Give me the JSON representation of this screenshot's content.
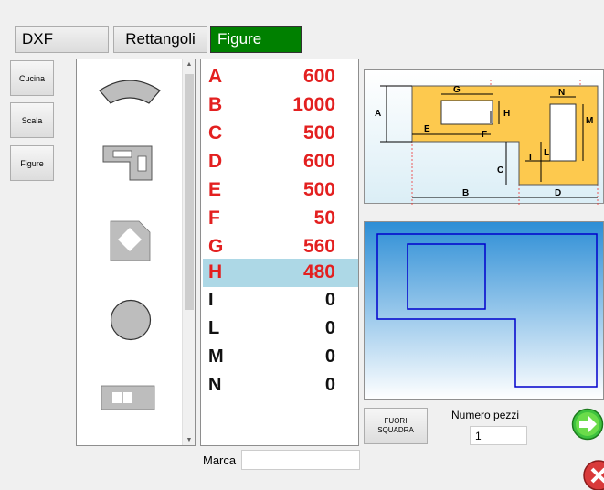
{
  "top_tabs": {
    "dxf": "DXF",
    "rettangoli": "Rettangoli",
    "figure": "Figure"
  },
  "side_buttons": {
    "cucina": "Cucina",
    "scala": "Scala",
    "figure": "Figure"
  },
  "shapes_list": {
    "icons": [
      "arc-shape-icon",
      "notched-rectangle-shape-icon",
      "diamond-cutout-shape-icon",
      "circle-shape-icon",
      "two-holes-shape-icon"
    ]
  },
  "params": [
    {
      "key": "A",
      "value": "600"
    },
    {
      "key": "B",
      "value": "1000"
    },
    {
      "key": "C",
      "value": "500"
    },
    {
      "key": "D",
      "value": "600"
    },
    {
      "key": "E",
      "value": "500"
    },
    {
      "key": "F",
      "value": "50"
    },
    {
      "key": "G",
      "value": "560"
    },
    {
      "key": "H",
      "value": "480",
      "selected": true
    },
    {
      "key": "I",
      "value": "0"
    },
    {
      "key": "L",
      "value": "0"
    },
    {
      "key": "M",
      "value": "0"
    },
    {
      "key": "N",
      "value": "0"
    }
  ],
  "marca": {
    "label": "Marca",
    "value": ""
  },
  "diagram_labels": {
    "a": "A",
    "b": "B",
    "c": "C",
    "d": "D",
    "e": "E",
    "f": "F",
    "g": "G",
    "h": "H",
    "i": "I",
    "l": "L",
    "m": "M",
    "n": "N"
  },
  "fuori_squadra": {
    "line1": "FUORI",
    "line2": "SQUADRA"
  },
  "numero_pezzi": {
    "label": "Numero pezzi",
    "value": "1"
  },
  "colors": {
    "active_tab": "#008000",
    "param_red": "#e32020",
    "selected_row": "#add8e6",
    "shape_fill": "#fdc94e",
    "outline_blue": "#0000cc"
  }
}
